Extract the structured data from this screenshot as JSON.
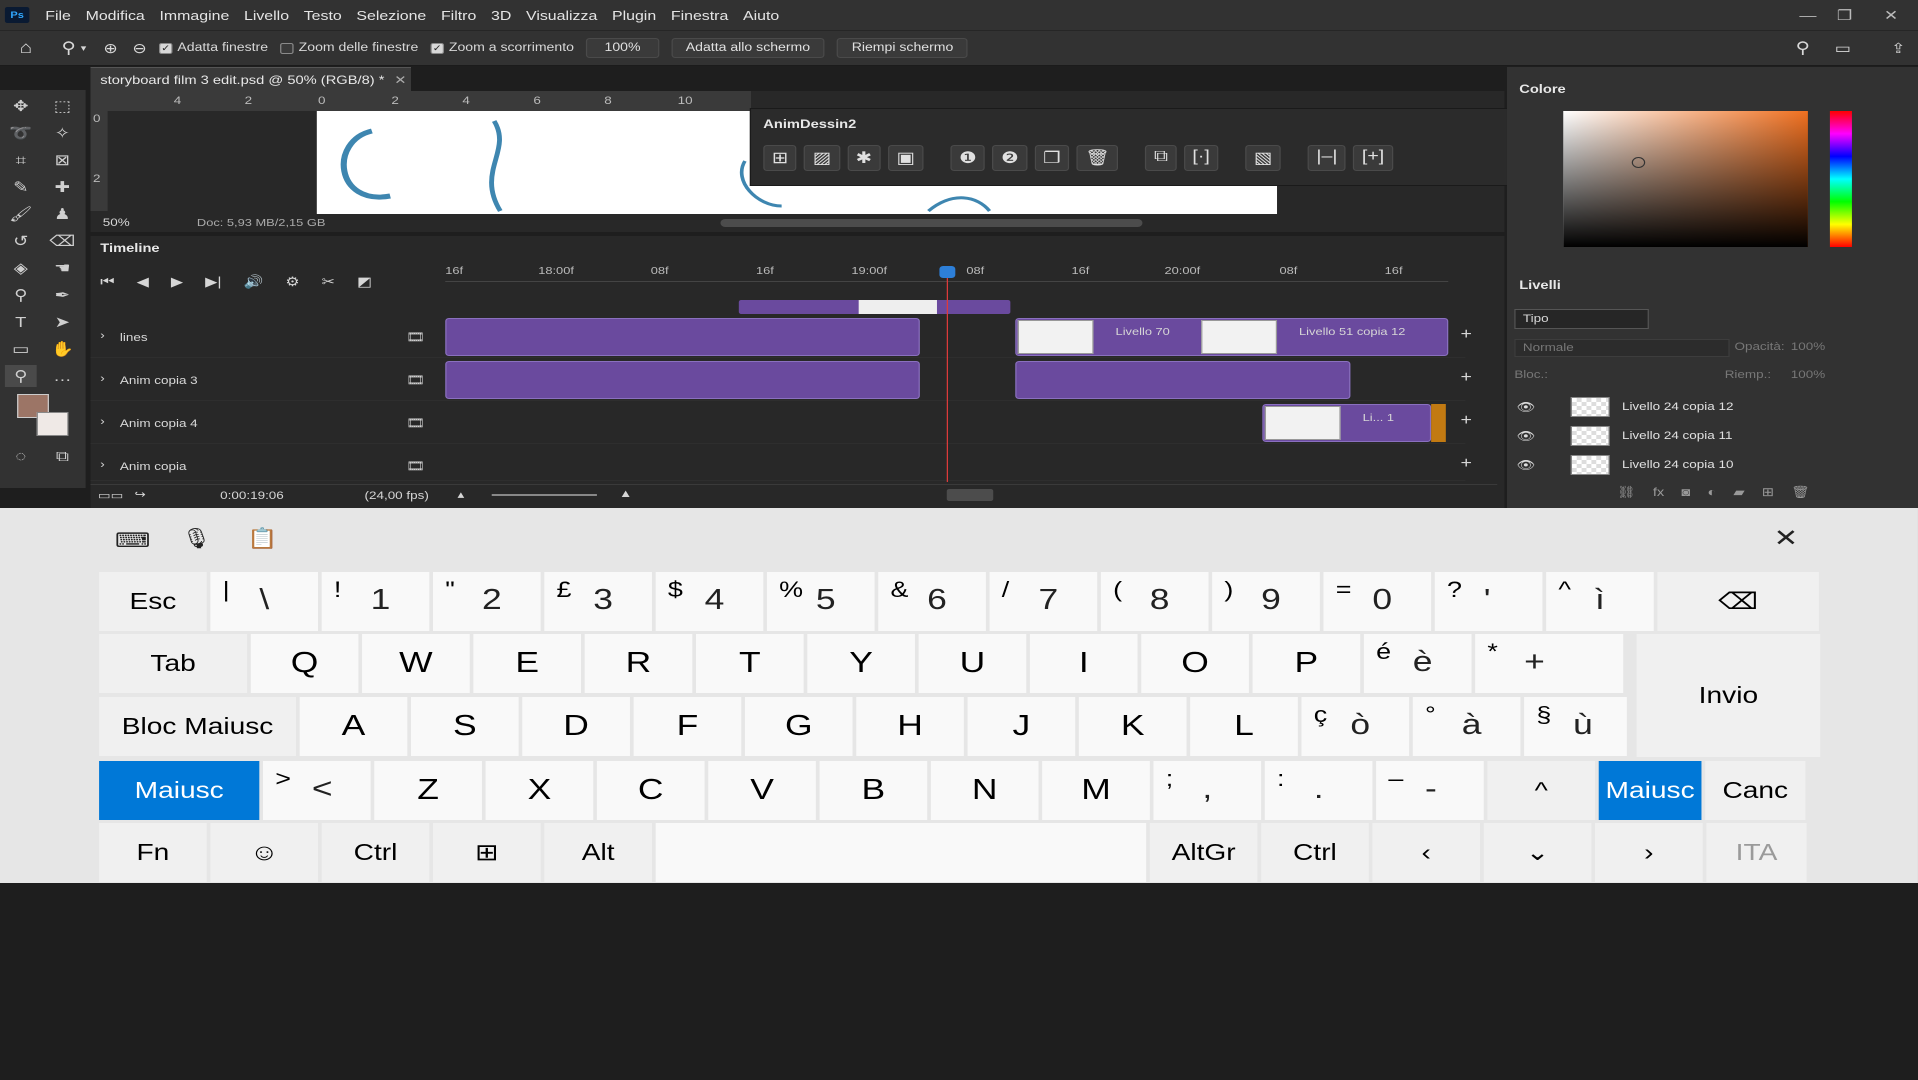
{
  "app": {
    "logo": "Ps",
    "menu": [
      "File",
      "Modifica",
      "Immagine",
      "Livello",
      "Testo",
      "Selezione",
      "Filtro",
      "3D",
      "Visualizza",
      "Plugin",
      "Finestra",
      "Aiuto"
    ]
  },
  "options": {
    "fit_windows": "Adatta finestre",
    "zoom_windows": "Zoom delle finestre",
    "scroll_zoom": "Zoom a scorrimento",
    "zoom_value": "100%",
    "fit_screen": "Adatta allo schermo",
    "fill_screen": "Riempi schermo"
  },
  "document": {
    "tab": "storyboard film 3 edit.psd @ 50% (RGB/8) *",
    "zoom": "50%",
    "doc_info": "Doc: 5,93 MB/2,15 GB",
    "ruler_labels": [
      "4",
      "2",
      "0",
      "2",
      "4",
      "6",
      "8",
      "10"
    ],
    "vruler": [
      "0",
      "2"
    ]
  },
  "anim_panel": {
    "title": "AnimDessin2"
  },
  "timeline": {
    "title": "Timeline",
    "ticks": [
      "16f",
      "18:00f",
      "08f",
      "16f",
      "19:00f",
      "08f",
      "16f",
      "20:00f",
      "08f",
      "16f"
    ],
    "tracks": [
      {
        "name": "lines"
      },
      {
        "name": "Anim copia 3"
      },
      {
        "name": "Anim copia 4"
      },
      {
        "name": "Anim copia"
      }
    ],
    "clips": {
      "livello70": "Livello 70",
      "livello51": "Livello 51 copia 12",
      "li1": "Li... 1"
    },
    "timecode": "0:00:19:06",
    "fps": "(24,00 fps)"
  },
  "color_panel": {
    "title": "Colore"
  },
  "layers_panel": {
    "title": "Livelli",
    "filter": "Tipo",
    "blend": "Normale",
    "opacity_label": "Opacità:",
    "opacity": "100%",
    "lock_label": "Bloc.:",
    "fill_label": "Riemp.:",
    "fill": "100%",
    "layers": [
      {
        "name": "Livello 24 copia 12"
      },
      {
        "name": "Livello 24 copia 11"
      },
      {
        "name": "Livello 24 copia 10"
      }
    ]
  },
  "colors": {
    "accent": "#0078d7",
    "clip": "#6a4a9e",
    "playhead": "#e03b3b",
    "fg_swatch": "#9c7566"
  },
  "keyboard": {
    "row1": [
      {
        "main": "Esc"
      },
      {
        "s": "|",
        "p": "\\"
      },
      {
        "s": "!",
        "p": "1"
      },
      {
        "s": "\"",
        "p": "2"
      },
      {
        "s": "£",
        "p": "3"
      },
      {
        "s": "$",
        "p": "4"
      },
      {
        "s": "%",
        "p": "5"
      },
      {
        "s": "&",
        "p": "6"
      },
      {
        "s": "/",
        "p": "7"
      },
      {
        "s": "(",
        "p": "8"
      },
      {
        "s": ")",
        "p": "9"
      },
      {
        "s": "=",
        "p": "0"
      },
      {
        "s": "?",
        "p": "'"
      },
      {
        "s": "^",
        "p": "ì"
      },
      {
        "main": "⌫"
      }
    ],
    "row2": [
      {
        "main": "Tab"
      },
      {
        "main": "Q"
      },
      {
        "main": "W"
      },
      {
        "main": "E"
      },
      {
        "main": "R"
      },
      {
        "main": "T"
      },
      {
        "main": "Y"
      },
      {
        "main": "U"
      },
      {
        "main": "I"
      },
      {
        "main": "O"
      },
      {
        "main": "P"
      },
      {
        "s": "é",
        "p": "è"
      },
      {
        "s": "*",
        "p": "+"
      }
    ],
    "enter": "Invio",
    "row3": [
      {
        "main": "Bloc Maiusc"
      },
      {
        "main": "A"
      },
      {
        "main": "S"
      },
      {
        "main": "D"
      },
      {
        "main": "F"
      },
      {
        "main": "G"
      },
      {
        "main": "H"
      },
      {
        "main": "J"
      },
      {
        "main": "K"
      },
      {
        "main": "L"
      },
      {
        "s": "ç",
        "p": "ò"
      },
      {
        "s": "°",
        "p": "à"
      },
      {
        "s": "§",
        "p": "ù"
      }
    ],
    "row4": [
      {
        "main": "Maiusc"
      },
      {
        "s": ">",
        "p": "<"
      },
      {
        "main": "Z"
      },
      {
        "main": "X"
      },
      {
        "main": "C"
      },
      {
        "main": "V"
      },
      {
        "main": "B"
      },
      {
        "main": "N"
      },
      {
        "main": "M"
      },
      {
        "s": ";",
        "p": ","
      },
      {
        "s": ":",
        "p": "."
      },
      {
        "s": "–",
        "p": "-"
      },
      {
        "main": "^"
      },
      {
        "main": "Maiusc"
      },
      {
        "main": "Canc"
      }
    ],
    "row5": [
      {
        "main": "Fn"
      },
      {
        "main": "☺"
      },
      {
        "main": "Ctrl"
      },
      {
        "main": "⊞"
      },
      {
        "main": "Alt"
      },
      {
        "main": ""
      },
      {
        "main": "AltGr"
      },
      {
        "main": "Ctrl"
      },
      {
        "main": "‹"
      },
      {
        "main": "⌄"
      },
      {
        "main": "›"
      },
      {
        "main": "ITA"
      }
    ]
  }
}
